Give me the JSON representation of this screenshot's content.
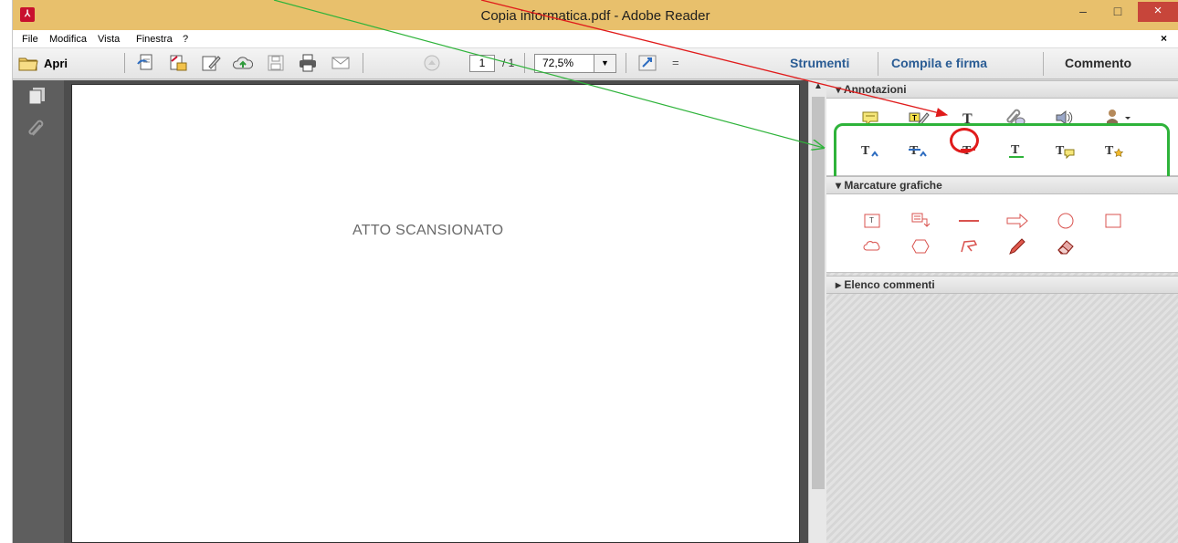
{
  "window": {
    "title": "Copia informatica.pdf - Adobe Reader",
    "controls": {
      "minimize": "–",
      "maximize": "□",
      "close": "×"
    }
  },
  "menubar": {
    "items": [
      "File",
      "Modifica",
      "Vista",
      "Finestra",
      "?"
    ],
    "close_doc": "×"
  },
  "toolbar": {
    "open_label": "Apri",
    "page_current": "1",
    "page_total": "/ 1",
    "zoom": "72,5%",
    "zoom_arrow": "▼",
    "more": "=",
    "tools_label": "Strumenti",
    "fill_sign_label": "Compila e firma",
    "comment_label": "Commento"
  },
  "document": {
    "text": "ATTO SCANSIONATO"
  },
  "comment_pane": {
    "annotations_header": "Annotazioni",
    "markup_header": "Marcature grafiche",
    "comments_list_header": "Elenco commenti",
    "expanded_marker": "▾",
    "collapsed_marker": "▸",
    "annotation_icons_row1": [
      "sticky-note-icon",
      "highlight-text-icon",
      "add-text-icon",
      "attach-file-icon",
      "record-audio-icon",
      "stamp-icon"
    ],
    "annotation_icons_row2": [
      "insert-text-icon",
      "replace-text-icon",
      "strikethrough-icon",
      "underline-icon",
      "add-note-to-text-icon",
      "text-correction-icon"
    ],
    "markup_icons_row1": [
      "text-box-icon",
      "callout-icon",
      "line-icon",
      "arrow-icon",
      "oval-icon",
      "rectangle-icon"
    ],
    "markup_icons_row2": [
      "cloud-icon",
      "polygon-icon",
      "connected-lines-icon",
      "pencil-icon",
      "eraser-icon"
    ]
  },
  "colors": {
    "titlebar": "#e8c06c",
    "close_button": "#c7453a",
    "link_blue": "#2a5c94",
    "highlight_green": "#2eb33a",
    "highlight_red": "#e01b1b",
    "markup_red": "#d9534f"
  }
}
